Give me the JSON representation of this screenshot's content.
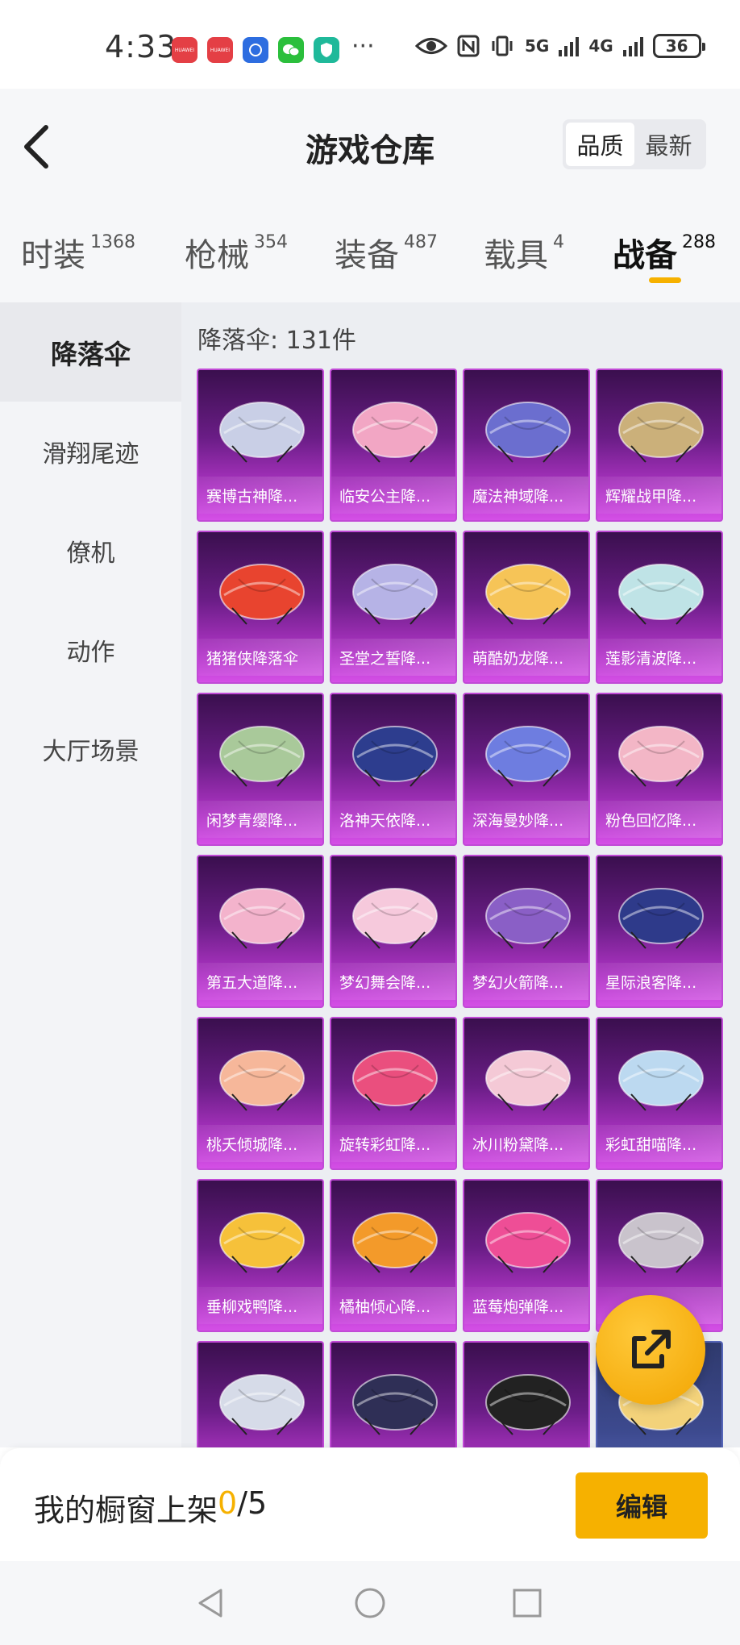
{
  "status_bar": {
    "time": "4:33",
    "network_1": "5G",
    "network_2": "4G",
    "battery": "36",
    "app_icons": [
      "huawei-appgallery-icon",
      "huawei-appgallery-icon",
      "app-icon",
      "wechat-icon",
      "security-icon"
    ]
  },
  "header": {
    "title": "游戏仓库",
    "sort_options": [
      "品质",
      "最新"
    ],
    "active_sort": "品质"
  },
  "category_tabs": [
    {
      "name": "时装",
      "count": "1368"
    },
    {
      "name": "枪械",
      "count": "354"
    },
    {
      "name": "装备",
      "count": "487"
    },
    {
      "name": "载具",
      "count": "4"
    },
    {
      "name": "战备",
      "count": "288",
      "active": true
    }
  ],
  "side_nav": [
    {
      "label": "降落伞",
      "active": true
    },
    {
      "label": "滑翔尾迹"
    },
    {
      "label": "僚机"
    },
    {
      "label": "动作"
    },
    {
      "label": "大厅场景"
    }
  ],
  "main": {
    "count_label": "降落伞: 131件",
    "items": [
      {
        "label": "赛博古神降...",
        "color": "#c9cfe6"
      },
      {
        "label": "临安公主降...",
        "color": "#f2a6c4"
      },
      {
        "label": "魔法神域降...",
        "color": "#6b6ecf"
      },
      {
        "label": "辉耀战甲降...",
        "color": "#cbb07a"
      },
      {
        "label": "猪猪侠降落伞",
        "color": "#e8442f"
      },
      {
        "label": "圣堂之誓降...",
        "color": "#b6b3e6"
      },
      {
        "label": "萌酷奶龙降...",
        "color": "#f6c457"
      },
      {
        "label": "莲影清波降...",
        "color": "#bfe3e6"
      },
      {
        "label": "闲梦青缨降...",
        "color": "#a9c99a"
      },
      {
        "label": "洛神天依降...",
        "color": "#2d3d8e"
      },
      {
        "label": "深海曼妙降...",
        "color": "#6e7de0"
      },
      {
        "label": "粉色回忆降...",
        "color": "#f3b6c6"
      },
      {
        "label": "第五大道降...",
        "color": "#f3b3cc"
      },
      {
        "label": "梦幻舞会降...",
        "color": "#f6c9dc"
      },
      {
        "label": "梦幻火箭降...",
        "color": "#8a5fc6"
      },
      {
        "label": "星际浪客降...",
        "color": "#2e3a8a"
      },
      {
        "label": "桃夭倾城降...",
        "color": "#f6b79a"
      },
      {
        "label": "旋转彩虹降...",
        "color": "#ea4f7e"
      },
      {
        "label": "冰川粉黛降...",
        "color": "#f4c9d6"
      },
      {
        "label": "彩虹甜喵降...",
        "color": "#bcd9f0"
      },
      {
        "label": "垂柳戏鸭降...",
        "color": "#f6c13a"
      },
      {
        "label": "橘柚倾心降...",
        "color": "#f39a2a"
      },
      {
        "label": "蓝莓炮弹降...",
        "color": "#ee4e96"
      },
      {
        "label": "",
        "color": "#c9c3cc"
      },
      {
        "label": "",
        "color": "#d6dbe8"
      },
      {
        "label": "",
        "color": "#2f2f56"
      },
      {
        "label": "",
        "color": "#222222"
      },
      {
        "label": "",
        "color": "#f3d27a"
      }
    ]
  },
  "share_button_icon": "share-icon",
  "bottom": {
    "showcase_text": "我的橱窗上架 ",
    "showcase_current": "0",
    "showcase_total": "/5",
    "edit_label": "编辑"
  },
  "colors": {
    "accent": "#f6b100",
    "card_purple": "#8a2aa6"
  }
}
